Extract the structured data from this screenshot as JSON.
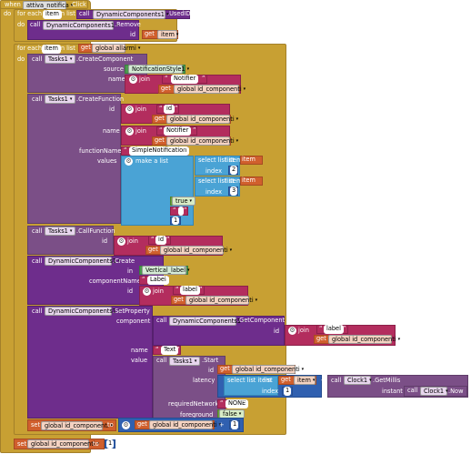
{
  "event": {
    "when": "when",
    "component": "attiva_notifica",
    "event": ".Click",
    "do": "do"
  },
  "kw": {
    "for_each": "for each",
    "item": "item",
    "in_list": "in list",
    "do": "do",
    "call": "call",
    "get": "get",
    "id": "id",
    "join": "join",
    "set": "set",
    "to": "to",
    "index": "index",
    "select_list_item": "select list item",
    "list": "list",
    "make_a_list": "make a list",
    "plus": "+",
    "minus": "-"
  },
  "loop1": {
    "component": "DynamicComponents1",
    "method": ".UsedIDs",
    "remove_component": "DynamicComponents1",
    "remove_method": ".Remove",
    "var": "item"
  },
  "loop2": {
    "var": "item",
    "list_var": "global allarmi"
  },
  "create_component": {
    "component": "Tasks1",
    "method": ".CreateComponent",
    "source_label": "source",
    "source_value": "NotificationStyle1",
    "name_label": "name",
    "notifier": "Notifier",
    "id_var": "global id_componenti"
  },
  "create_function": {
    "component": "Tasks1",
    "method": ".CreateFunction",
    "id_label": "id",
    "id_text": "id",
    "name_label": "name",
    "notifier": "Notifier",
    "function_label": "functionName",
    "function_value": "SimpleNotification",
    "values_label": "values",
    "item_var": "item",
    "index1": "2",
    "index2": "3",
    "true_value": "true",
    "empty_text": "",
    "one": "1",
    "id_var": "global id_componenti"
  },
  "call_function": {
    "component": "Tasks1",
    "method": ".CallFunction",
    "id_label": "id",
    "id_text": "id",
    "id_var": "global id_componenti"
  },
  "dynamic_create": {
    "component": "DynamicComponents1",
    "method": ".Create",
    "in_label": "in",
    "in_value": "Vertical_label",
    "component_label": "componentName",
    "component_value": "Label",
    "id_label": "id",
    "id_text": "label",
    "id_var": "global id_componenti"
  },
  "set_property": {
    "component": "DynamicComponents1",
    "method": ".SetProperty",
    "component_label": "component",
    "get_component": "DynamicComponents1",
    "get_method": ".GetComponent",
    "id_label": "id",
    "id_text": "label",
    "id_var": "global id_componenti",
    "name_label": "name",
    "name_value": "Text",
    "value_label": "value",
    "start_component": "Tasks1",
    "start_method": ".Start",
    "start_id_label": "id",
    "start_id_var": "global id_componenti",
    "latency_label": "latency",
    "item_var": "item",
    "index_value": "1",
    "clock": "Clock1",
    "clock_method": ".GetMillis",
    "instant_label": "instant",
    "clock2": "Clock1",
    "clock2_method": ".Now",
    "network_label": "requiredNetwork",
    "network_value": "NONE",
    "foreground_label": "foreground",
    "foreground_value": "false"
  },
  "set_increment": {
    "var": "global id_componenti",
    "get_var": "global id_componenti",
    "one": "1"
  },
  "set_reset": {
    "var": "global id_componenti",
    "value": "1"
  }
}
